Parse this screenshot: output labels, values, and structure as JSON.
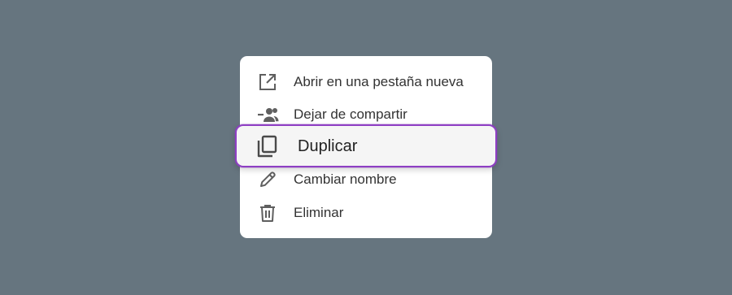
{
  "menu": {
    "items": [
      {
        "label": "Abrir en una pestaña nueva",
        "icon": "open-in-new-icon"
      },
      {
        "label": "Dejar de compartir",
        "icon": "remove-people-icon"
      },
      {
        "label": "Duplicar",
        "icon": "copy-icon",
        "highlighted": true
      },
      {
        "label": "Cambiar nombre",
        "icon": "pencil-icon"
      },
      {
        "label": "Eliminar",
        "icon": "trash-icon"
      }
    ]
  },
  "colors": {
    "background": "#66757f",
    "menu_background": "#ffffff",
    "highlight_border": "#8e3fc3",
    "highlight_background": "#f5f5f5",
    "icon": "#5f5f5f",
    "text": "#333333"
  }
}
